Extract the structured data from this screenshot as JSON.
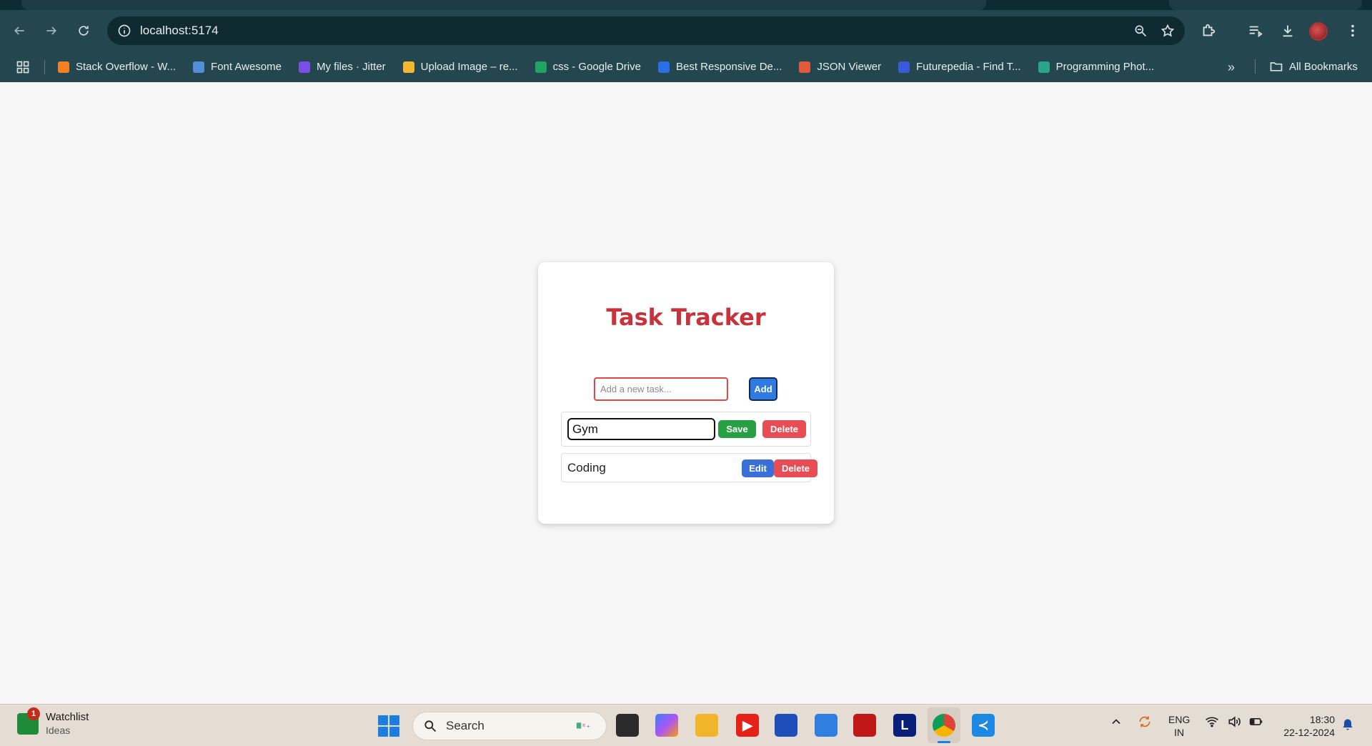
{
  "browser": {
    "url": "localhost:5174",
    "bookmarks": [
      {
        "label": "Stack Overflow - W...",
        "color": "#f48024"
      },
      {
        "label": "Font Awesome",
        "color": "#528dd7"
      },
      {
        "label": "My files · Jitter",
        "color": "#7b4ee6"
      },
      {
        "label": "Upload Image – re...",
        "color": "#f2b632"
      },
      {
        "label": "css - Google Drive",
        "color": "#1fa463"
      },
      {
        "label": "Best Responsive De...",
        "color": "#2a6ee8"
      },
      {
        "label": "JSON Viewer",
        "color": "#e25a3b"
      },
      {
        "label": "Futurepedia - Find T...",
        "color": "#3a5bd9"
      },
      {
        "label": "Programming Phot...",
        "color": "#2aa58a"
      }
    ],
    "all_bookmarks": "All Bookmarks"
  },
  "app": {
    "title": "Task Tracker",
    "new_task_placeholder": "Add a new task...",
    "add_label": "Add",
    "tasks": [
      {
        "text": "Gym",
        "editing": true,
        "save_label": "Save",
        "delete_label": "Delete"
      },
      {
        "text": "Coding",
        "editing": false,
        "edit_label": "Edit",
        "delete_label": "Delete"
      }
    ]
  },
  "taskbar": {
    "widget_title": "Watchlist",
    "widget_subtitle": "Ideas",
    "widget_badge": "1",
    "search_label": "Search",
    "lang_line1": "ENG",
    "lang_line2": "IN",
    "time": "18:30",
    "date": "22-12-2024",
    "apps": [
      "file-explorer",
      "copilot",
      "folder",
      "youtube",
      "store",
      "azure",
      "mcafee",
      "l-app",
      "chrome",
      "vscode"
    ]
  }
}
